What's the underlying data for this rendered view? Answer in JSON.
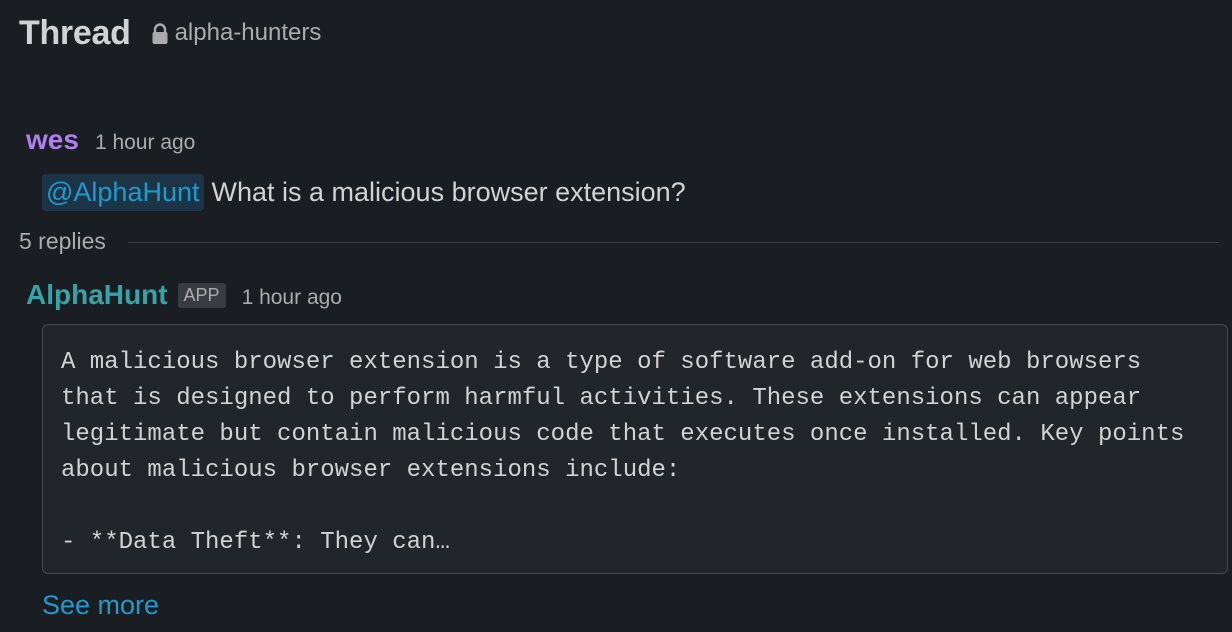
{
  "header": {
    "title": "Thread",
    "lock_icon": "lock-icon",
    "channel": "alpha-hunters"
  },
  "parent_message": {
    "author": "wes",
    "timestamp": "1 hour ago",
    "mention": "@AlphaHunt",
    "text": "What is a malicious browser extension?"
  },
  "replies": {
    "count_label": "5 replies"
  },
  "reply_message": {
    "author": "AlphaHunt",
    "badge": "APP",
    "timestamp": "1 hour ago",
    "code_text": "A malicious browser extension is a type of software add-on for web browsers\nthat is designed to perform harmful activities. These extensions can appear\nlegitimate but contain malicious code that executes once installed. Key points\nabout malicious browser extensions include:\n\n- **Data Theft**: They can…",
    "see_more": "See more"
  },
  "colors": {
    "background": "#1a1d21",
    "author_user": "#b07ff0",
    "author_bot": "#36a3a8",
    "link": "#1d9bd1"
  }
}
